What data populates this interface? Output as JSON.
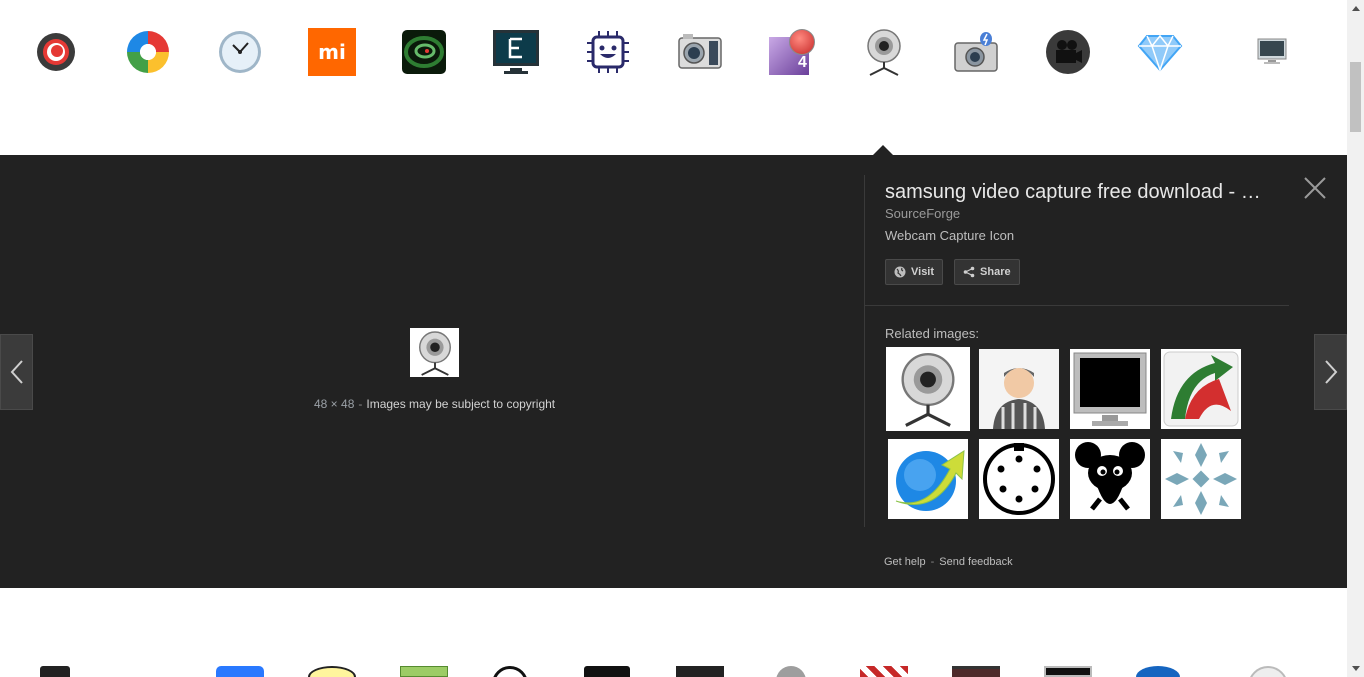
{
  "top_thumbnails": [
    {
      "icon": "red-record-circle-icon"
    },
    {
      "icon": "rainbow-swirl-icon"
    },
    {
      "icon": "clock-icon"
    },
    {
      "icon": "mi-logo-icon",
      "label": "mi"
    },
    {
      "icon": "green-spiral-icon"
    },
    {
      "icon": "monitor-e-icon"
    },
    {
      "icon": "smiling-chip-icon"
    },
    {
      "icon": "camera-icon"
    },
    {
      "icon": "purple-record-4-icon",
      "label": "4"
    },
    {
      "icon": "webcam-icon"
    },
    {
      "icon": "camera-flash-icon"
    },
    {
      "icon": "movie-camera-icon"
    },
    {
      "icon": "blue-gem-icon"
    },
    {
      "icon": "small-monitor-icon"
    }
  ],
  "preview": {
    "dimensions": "48 × 48",
    "separator": "-",
    "copyright": "Images may be subject to copyright",
    "title": "samsung video capture free download - SourceForge",
    "source": "SourceForge",
    "description": "Webcam Capture Icon",
    "visit_label": "Visit",
    "share_label": "Share",
    "related_label": "Related images:",
    "related": [
      {
        "icon": "webcam-icon"
      },
      {
        "icon": "prisoner-icon"
      },
      {
        "icon": "black-monitor-icon"
      },
      {
        "icon": "red-green-arrow-icon"
      },
      {
        "icon": "blue-globe-arrow-icon"
      },
      {
        "icon": "din-connector-icon"
      },
      {
        "icon": "black-mouse-character-icon"
      },
      {
        "icon": "snowflake-pattern-icon"
      }
    ],
    "help_label": "Get help",
    "feedback_label": "Send feedback"
  },
  "colors": {
    "panel_bg": "#222222",
    "accent_red": "#e53935",
    "mi_orange": "#ff6700"
  }
}
